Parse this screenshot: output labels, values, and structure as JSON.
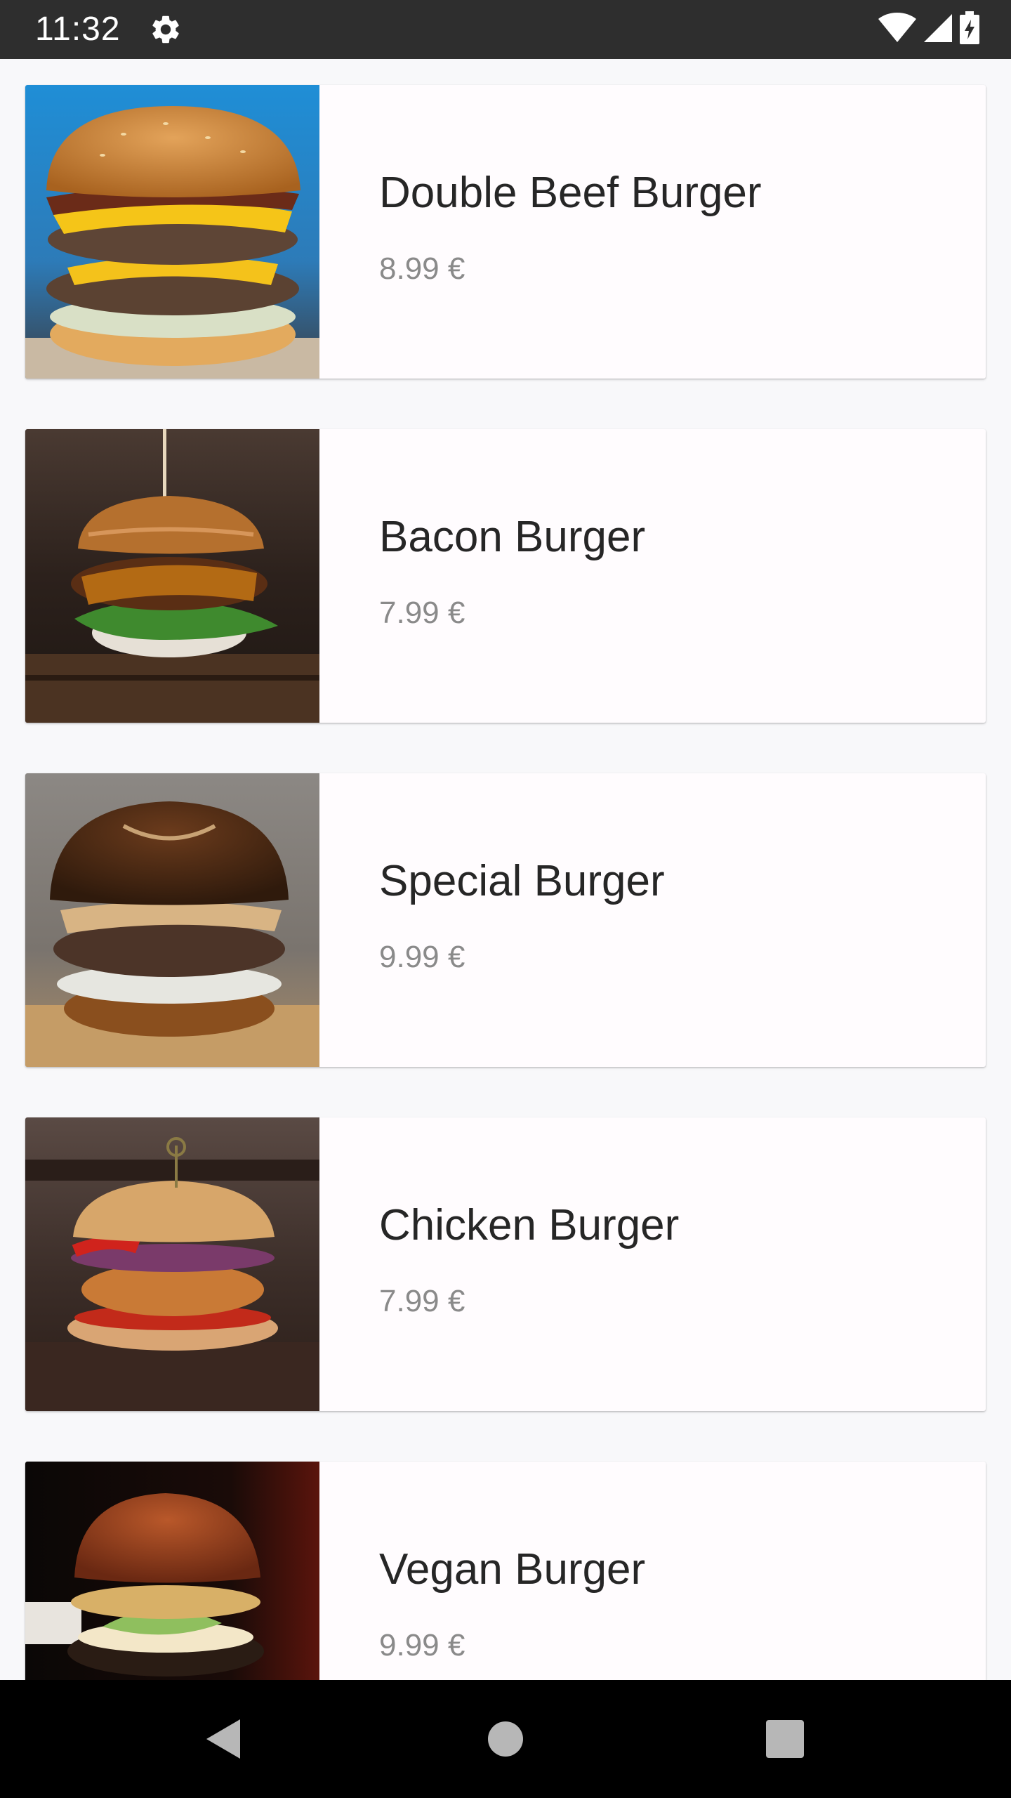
{
  "status_bar": {
    "time": "11:32",
    "icons": [
      "gear-icon",
      "wifi-icon",
      "cell-signal-icon",
      "battery-charging-icon"
    ]
  },
  "menu": {
    "items": [
      {
        "name": "Double Beef Burger",
        "price": "8.99 €",
        "image": "double-beef-burger-photo"
      },
      {
        "name": "Bacon Burger",
        "price": "7.99 €",
        "image": "bacon-burger-photo"
      },
      {
        "name": "Special Burger",
        "price": "9.99 €",
        "image": "special-burger-photo"
      },
      {
        "name": "Chicken Burger",
        "price": "7.99 €",
        "image": "chicken-burger-photo"
      },
      {
        "name": "Vegan Burger",
        "price": "9.99 €",
        "image": "vegan-burger-photo"
      }
    ]
  },
  "nav_bar": {
    "buttons": [
      "back-icon",
      "home-icon",
      "recents-icon"
    ]
  },
  "colors": {
    "status_bar": "#2e2e2e",
    "background": "#f8f8fa",
    "card": "#fffcfe",
    "name_text": "#262626",
    "price_text": "#8a8a8a",
    "nav_bar": "#000000"
  }
}
